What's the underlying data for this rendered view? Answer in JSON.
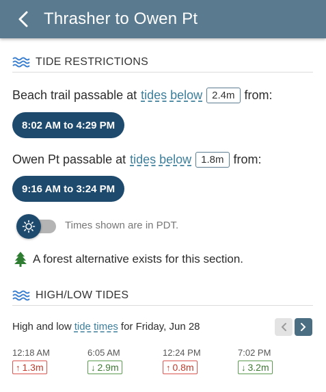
{
  "header": {
    "title": "Thrasher to Owen Pt"
  },
  "restrictions": {
    "heading": "TIDE RESTRICTIONS",
    "beach": {
      "prefix": "Beach trail passable at",
      "link": "tides below",
      "height": "2.4m",
      "suffix": "from:",
      "window": "8:02 AM to 4:29 PM"
    },
    "owen": {
      "prefix": "Owen Pt passable at",
      "link": "tides below",
      "height": "1.8m",
      "suffix": "from:",
      "window": "9:16 AM to 3:24 PM"
    },
    "timezone_note": "Times shown are in PDT.",
    "forest_note": "A forest alternative exists for this section."
  },
  "tides": {
    "heading": "HIGH/LOW TIDES",
    "day_prefix": "High and low",
    "day_link": "tide times",
    "day_suffix": "for Friday, Jun 28",
    "entries": [
      {
        "time": "12:18 AM",
        "height": "1.3m",
        "direction": "up"
      },
      {
        "time": "6:05 AM",
        "height": "2.9m",
        "direction": "down"
      },
      {
        "time": "12:24 PM",
        "height": "0.8m",
        "direction": "up"
      },
      {
        "time": "7:02 PM",
        "height": "3.2m",
        "direction": "down"
      }
    ]
  },
  "colors": {
    "header_bg": "#5a7b8f",
    "pill_bg": "#1e4a6e",
    "link": "#3d7e9a",
    "high_tide": "#c0392b",
    "low_tide": "#3d7a32"
  }
}
